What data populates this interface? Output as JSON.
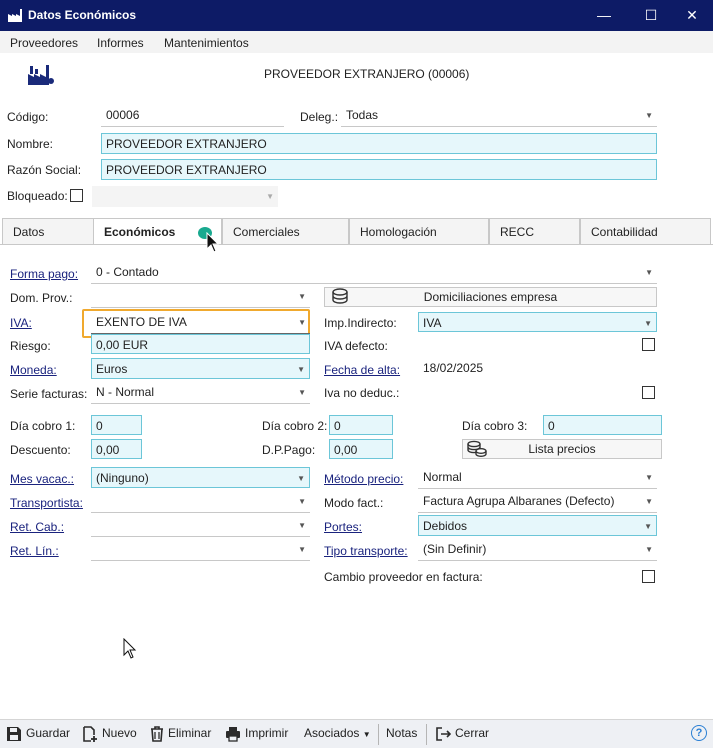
{
  "window": {
    "title": "Datos Económicos",
    "minimize": "—",
    "maximize": "☐",
    "close": "✕"
  },
  "menu": [
    "Proveedores",
    "Informes",
    "Mantenimientos"
  ],
  "header": {
    "title": "PROVEEDOR EXTRANJERO (00006)"
  },
  "general": {
    "codigo_label": "Código:",
    "codigo_value": "00006",
    "deleg_label": "Deleg.:",
    "deleg_value": "Todas",
    "nombre_label": "Nombre:",
    "nombre_value": "PROVEEDOR EXTRANJERO",
    "razon_label": "Razón Social:",
    "razon_value": "PROVEEDOR EXTRANJERO",
    "bloqueado_label": "Bloqueado:"
  },
  "tabs": [
    "Datos",
    "Económicos",
    "Comerciales",
    "Homologación",
    "RECC",
    "Contabilidad"
  ],
  "form": {
    "forma_pago_label": "Forma pago:",
    "forma_pago_value": "0 - Contado",
    "dom_prov_label": "Dom. Prov.:",
    "dom_prov_value": "",
    "domiciliaciones_btn": "Domiciliaciones empresa",
    "iva_label": "IVA:",
    "iva_value": "EXENTO DE IVA",
    "imp_indirecto_label": "Imp.Indirecto:",
    "imp_indirecto_value": "IVA",
    "riesgo_label": "Riesgo:",
    "riesgo_value": "0,00 EUR",
    "iva_defecto_label": "IVA defecto:",
    "moneda_label": "Moneda:",
    "moneda_value": "Euros",
    "fecha_alta_label": "Fecha de alta:",
    "fecha_alta_value": "18/02/2025",
    "serie_label": "Serie facturas:",
    "serie_value": "N - Normal",
    "iva_no_deduc_label": "Iva no deduc.:",
    "dia1_label": "Día cobro 1:",
    "dia1_value": "0",
    "dia2_label": "Día cobro 2:",
    "dia2_value": "0",
    "dia3_label": "Día cobro 3:",
    "dia3_value": "0",
    "descuento_label": "Descuento:",
    "descuento_value": "0,00",
    "dppago_label": "D.P.Pago:",
    "dppago_value": "0,00",
    "lista_precios_btn": "Lista precios",
    "mes_vacac_label": "Mes vacac.:",
    "mes_vacac_value": "(Ninguno)",
    "metodo_label": "Método precio:",
    "metodo_value": "Normal",
    "transportista_label": "Transportista:",
    "transportista_value": "",
    "modo_fact_label": "Modo fact.:",
    "modo_fact_value": "Factura Agrupa Albaranes (Defecto)",
    "ret_cab_label": "Ret. Cab.:",
    "ret_cab_value": "",
    "portes_label": "Portes:",
    "portes_value": "Debidos",
    "ret_lin_label": "Ret. Lín.:",
    "ret_lin_value": "",
    "tipo_transp_label": "Tipo transporte:",
    "tipo_transp_value": "(Sin Definir)",
    "cambio_prov_label": "Cambio proveedor en factura:"
  },
  "toolbar": {
    "guardar": "Guardar",
    "nuevo": "Nuevo",
    "eliminar": "Eliminar",
    "imprimir": "Imprimir",
    "asociados": "Asociados",
    "notas": "Notas",
    "cerrar": "Cerrar",
    "help": "?"
  },
  "colors": {
    "titlebar": "#0d1b66",
    "highlight_border": "#f0a92e",
    "field_bg": "#e6f7fb",
    "field_border": "#6cc6d8"
  }
}
